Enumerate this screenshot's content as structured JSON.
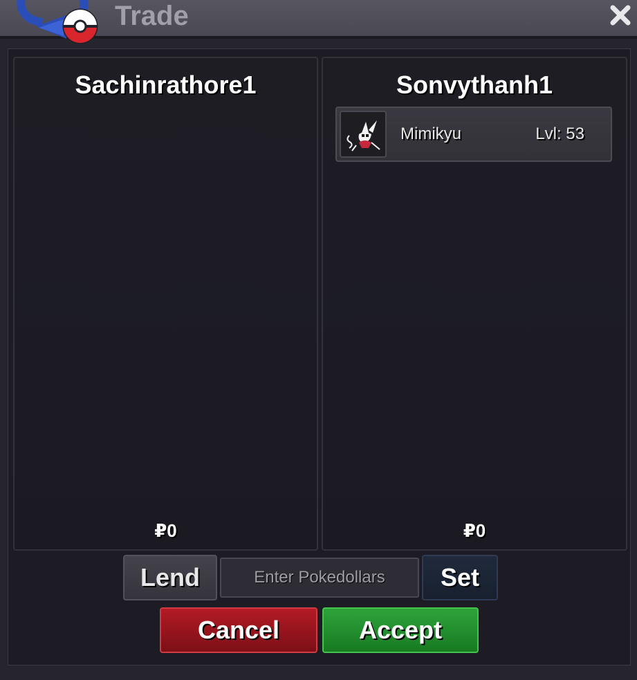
{
  "window": {
    "title": "Trade",
    "close_label": "×"
  },
  "left_panel": {
    "player_name": "Sachinrathore1",
    "money": "₽0"
  },
  "right_panel": {
    "player_name": "Sonvythanh1",
    "money": "₽0",
    "pokemon": [
      {
        "name": "Mimikyu",
        "level_text": "Lvl: 53"
      }
    ]
  },
  "controls": {
    "lend_label": "Lend",
    "pokedollars_placeholder": "Enter Pokedollars",
    "pokedollars_value": "",
    "set_label": "Set",
    "cancel_label": "Cancel",
    "accept_label": "Accept"
  },
  "colors": {
    "cancel": "#9e1520",
    "accept": "#25913a",
    "set": "#1c2536"
  }
}
